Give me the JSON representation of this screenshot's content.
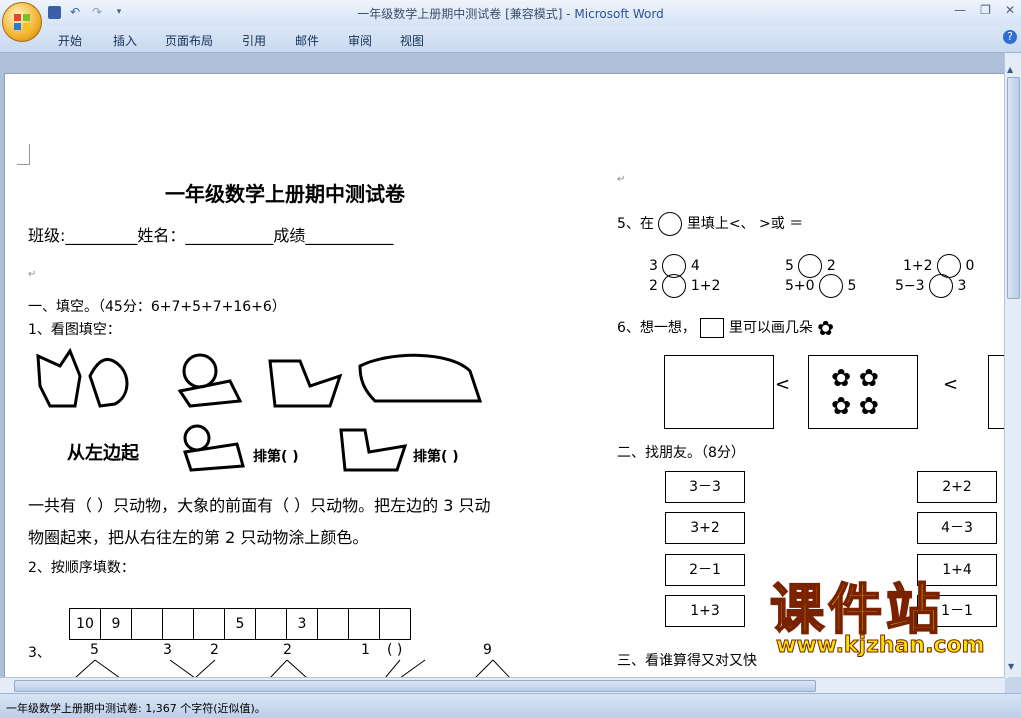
{
  "window": {
    "title": "一年级数学上册期中测试卷 [兼容模式] - ",
    "app_name": "Microsoft Word"
  },
  "ribbon": {
    "tabs": [
      "开始",
      "插入",
      "页面布局",
      "引用",
      "邮件",
      "审阅",
      "视图"
    ]
  },
  "doc": {
    "title": "一年级数学上册期中测试卷",
    "info_line": "班级:_________姓名：___________成绩___________",
    "section1": "一、填空。（45分：6+7+5+7+16+6）",
    "q1": "1、看图填空：",
    "animals_caption_left": "从左边起",
    "rank_label": "排第(  )",
    "q1_text_a": "一共有（   ）只动物，大象的前面有（   ）只动物。把左边的 3 只动",
    "q1_text_b": "物圈起来，把从右往左的第 2 只动物涂上颜色。",
    "q2": "2、按顺序填数：",
    "sequence": [
      "10",
      "9",
      "",
      "",
      "",
      "5",
      "",
      "3",
      "",
      "",
      ""
    ],
    "q3": "3、",
    "q3_numbers": [
      "5",
      "3",
      "2",
      "2",
      "1",
      "(  )",
      "9"
    ],
    "q5_prefix": "5、在",
    "q5_suffix": "里填上<、 >或 ＝",
    "q5_row1": [
      "3",
      "4",
      "5",
      "2",
      "1+2",
      "0"
    ],
    "q5_row2": [
      "2",
      "1+2",
      "5+0",
      "5",
      "5−3",
      "3"
    ],
    "q6_prefix": "6、想一想，",
    "q6_suffix": "里可以画几朵",
    "lt": "<",
    "section2": "二、找朋友。（8分）",
    "friends_left": [
      "3－3",
      "3+2",
      "2－1",
      "1+3"
    ],
    "friends_right": [
      "2+2",
      "4－3",
      "1+4",
      "1－1"
    ],
    "section3": "三、看谁算得又对又快"
  },
  "status": {
    "text": "一年级数学上册期中测试卷: 1,367 个字符(近似值)。"
  },
  "watermark": {
    "big": "课件站",
    "url": "www.kjzhan.com"
  }
}
